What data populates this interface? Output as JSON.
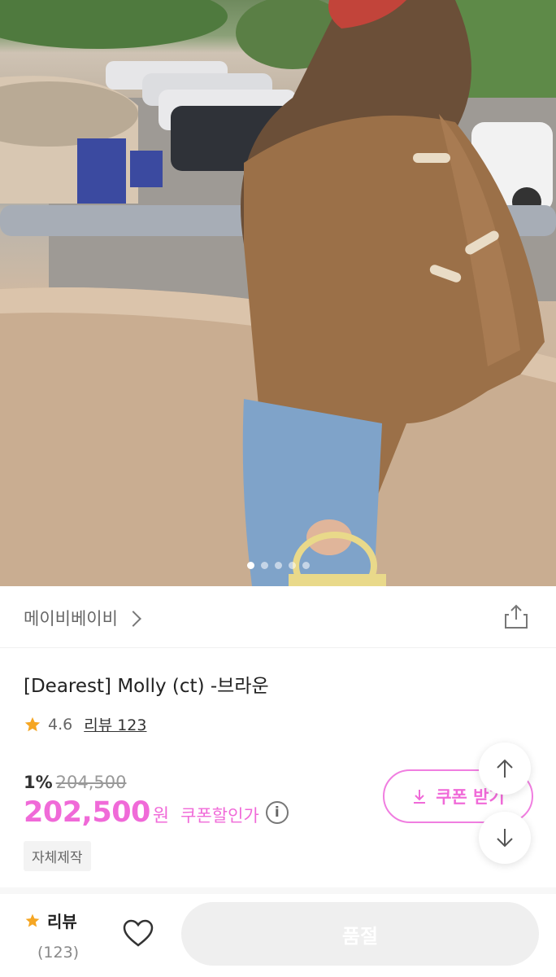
{
  "hero": {
    "dots_total": 5,
    "dots_active_index": 0
  },
  "brand": {
    "name": "메이비베이비",
    "chevron_icon": "chevron-right-icon",
    "share_icon": "share-icon"
  },
  "product": {
    "title": "[Dearest] Molly (ct) -브라운",
    "rating": "4.6",
    "review_link": "리뷰 123",
    "discount": "1%",
    "original_price": "204,500",
    "price": "202,500",
    "currency": "원",
    "coupon_price_label": "쿠폰할인가",
    "info_icon_glyph": "i",
    "tag": "자체제작"
  },
  "coupon_button": {
    "label": "쿠폰 받기",
    "icon": "download-icon"
  },
  "float_buttons": {
    "up_icon": "arrow-up-icon",
    "down_icon": "arrow-down-icon"
  },
  "bottom_bar": {
    "review_label": "리뷰",
    "review_count": "(123)",
    "wish_icon": "heart-icon",
    "soldout_label": "품절"
  },
  "colors": {
    "accent": "#f06ad8",
    "star": "#f5a623",
    "disabled_button": "#efefef"
  }
}
